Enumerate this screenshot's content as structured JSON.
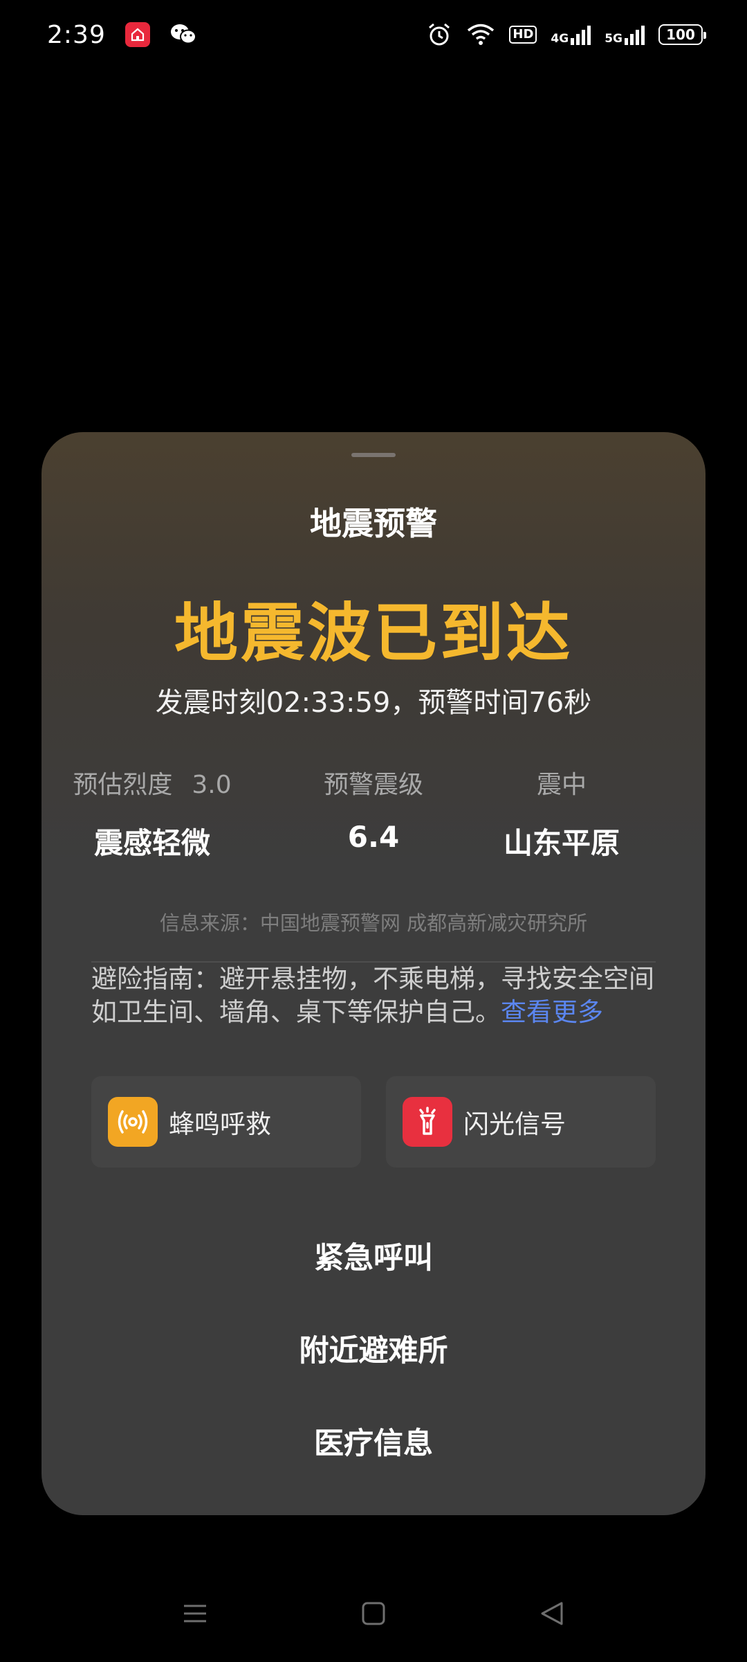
{
  "status_bar": {
    "time": "2:39",
    "hd": "HD",
    "net1": "4G",
    "net2": "5G",
    "battery": "100"
  },
  "sheet": {
    "title": "地震预警",
    "headline": "地震波已到达",
    "subline": "发震时刻02:33:59，预警时间76秒",
    "stats": [
      {
        "label": "预估烈度",
        "extra": "3.0",
        "value": "震感轻微"
      },
      {
        "label": "预警震级",
        "value": "6.4"
      },
      {
        "label": "震中",
        "value": "山东平原"
      }
    ],
    "source": "信息来源：中国地震预警网 成都高新减灾研究所",
    "guide_line1": "避险指南：避开悬挂物，不乘电梯，寻找安全空间",
    "guide_line2": "如卫生间、墙角、桌下等保护自己。",
    "guide_more": "查看更多",
    "actions": [
      {
        "label": "蜂鸣呼救",
        "icon": "siren-icon",
        "color": "#f2a623"
      },
      {
        "label": "闪光信号",
        "icon": "flashlight-icon",
        "color": "#e8303f"
      }
    ],
    "menu": [
      "紧急呼叫",
      "附近避难所",
      "医疗信息"
    ]
  },
  "colors": {
    "accent": "#f5b82e",
    "link": "#5b86f0"
  }
}
